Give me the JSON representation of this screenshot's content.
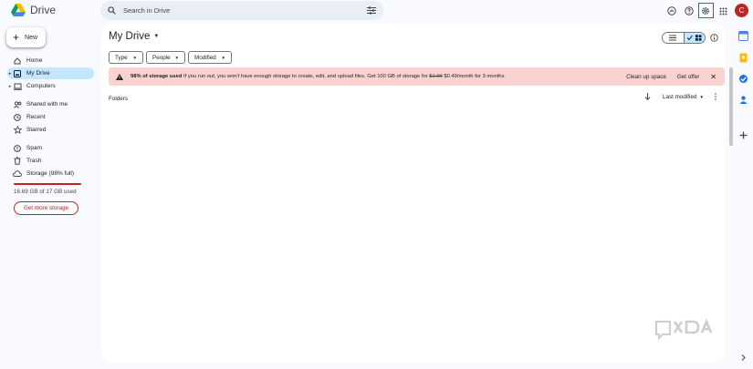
{
  "app": {
    "name": "Drive"
  },
  "search": {
    "placeholder": "Search in Drive"
  },
  "header": {
    "avatar_initial": "C"
  },
  "sidebar": {
    "new_label": "New",
    "items": [
      {
        "label": "Home",
        "icon": "home-icon"
      },
      {
        "label": "My Drive",
        "icon": "my-drive-icon",
        "active": true
      },
      {
        "label": "Computers",
        "icon": "computers-icon"
      },
      {
        "label": "Shared with me",
        "icon": "shared-icon"
      },
      {
        "label": "Recent",
        "icon": "clock-icon"
      },
      {
        "label": "Starred",
        "icon": "star-icon"
      },
      {
        "label": "Spam",
        "icon": "spam-icon"
      },
      {
        "label": "Trash",
        "icon": "trash-icon"
      },
      {
        "label": "Storage (98% full)",
        "icon": "cloud-icon"
      }
    ],
    "storage_used": "16.69 GB of 17 GB used",
    "storage_fraction": 0.98,
    "get_storage_label": "Get more storage"
  },
  "main": {
    "title": "My Drive",
    "filters": [
      "Type",
      "People",
      "Modified"
    ],
    "banner": {
      "bold": "98% of storage used",
      "text": " If you run out, you won't have enough storage to create, edit, and upload files. Get 100 GB of storage for ",
      "old_price": "$1.99",
      "text2": " $0.49/month for 3 months.",
      "action1": "Clean up space",
      "action2": "Get offer"
    },
    "folders_label": "Folders",
    "sort_label": "Last modified"
  },
  "watermark": "XDA",
  "colors": {
    "accent": "#c2e7ff",
    "warning": "#c5221f",
    "banner_bg": "#fad2cf"
  }
}
